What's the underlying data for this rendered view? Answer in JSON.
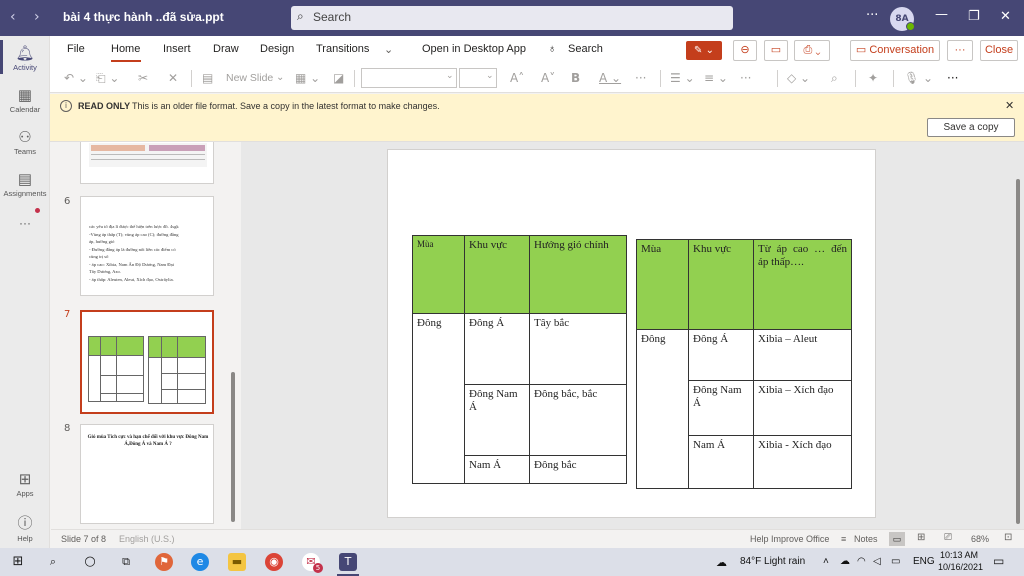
{
  "titlebar": {
    "back": "‹",
    "forward": "›",
    "doc_title": "bài 4 thực hành ..đã sửa.ppt",
    "search_placeholder": "Search",
    "more": "···",
    "avatar_initials": "8A"
  },
  "rail": {
    "items": [
      {
        "label": "Activity"
      },
      {
        "label": "Calendar"
      },
      {
        "label": "Teams"
      },
      {
        "label": "Assignments"
      },
      {
        "label": "···"
      },
      {
        "label": "Apps"
      },
      {
        "label": "Help"
      }
    ]
  },
  "ribbon": {
    "tabs": [
      "File",
      "Home",
      "Insert",
      "Draw",
      "Design",
      "Transitions",
      "Open in Desktop App",
      "Search"
    ],
    "conversation": "Conversation",
    "close": "Close",
    "more": "···",
    "new_slide": "New Slide"
  },
  "infobar": {
    "bold": "READ ONLY",
    "text": "This is an older file format. Save a copy in the latest format to make changes.",
    "button": "Save a copy"
  },
  "thumbs": {
    "n6": "6",
    "n7": "7",
    "n8": "8",
    "t6_lines": [
      "các yếu tố địa lí được thể hiện trên lược đồ. 4sgk",
      "-Vùng áp thấp (T); vùng áp cao (C); đường đẳng",
      "  áp, hướng gió",
      "- Đường đẳng áp là đường nối liền các điểm có",
      "  cùng trị số",
      "- áp cao: Xibia, Nam Ấn Độ Dương, Nam Đại",
      "  Tây Dương, Azo.",
      "- áp thấp: Aleuten, Aleut, Xích đạo, Oxtrâylia."
    ],
    "t8_title": "Gió mùa Tích cực và hạn chế đối với khu vực Đông Nam Á,Đông Á và Nam Á ?"
  },
  "table1": {
    "headers": [
      "Mùa",
      "Khu vực",
      "Hướng gió chính"
    ],
    "season": "Đông",
    "rows": [
      [
        "Đông Á",
        "Tây bắc"
      ],
      [
        "Đông Nam Á",
        "Đông bắc, bắc"
      ],
      [
        "Nam Á",
        "Đông bắc"
      ]
    ]
  },
  "table2": {
    "headers": [
      "Mùa",
      "Khu vực",
      "Từ áp cao … đến áp thấp…."
    ],
    "season": "Đông",
    "rows": [
      [
        "Đông Á",
        "Xibia – Aleut"
      ],
      [
        "Đông Nam Á",
        "Xibia – Xích đạo"
      ],
      [
        "Nam Á",
        "Xibia - Xích đạo"
      ]
    ]
  },
  "status": {
    "slide": "Slide 7 of 8",
    "lang": "English (U.S.)",
    "help": "Help Improve Office",
    "notes": "Notes",
    "zoom": "68%"
  },
  "taskbar": {
    "weather": "84°F  Light rain",
    "lang": "ENG",
    "time": "10:13 AM",
    "date": "10/16/2021",
    "badge": "5"
  }
}
